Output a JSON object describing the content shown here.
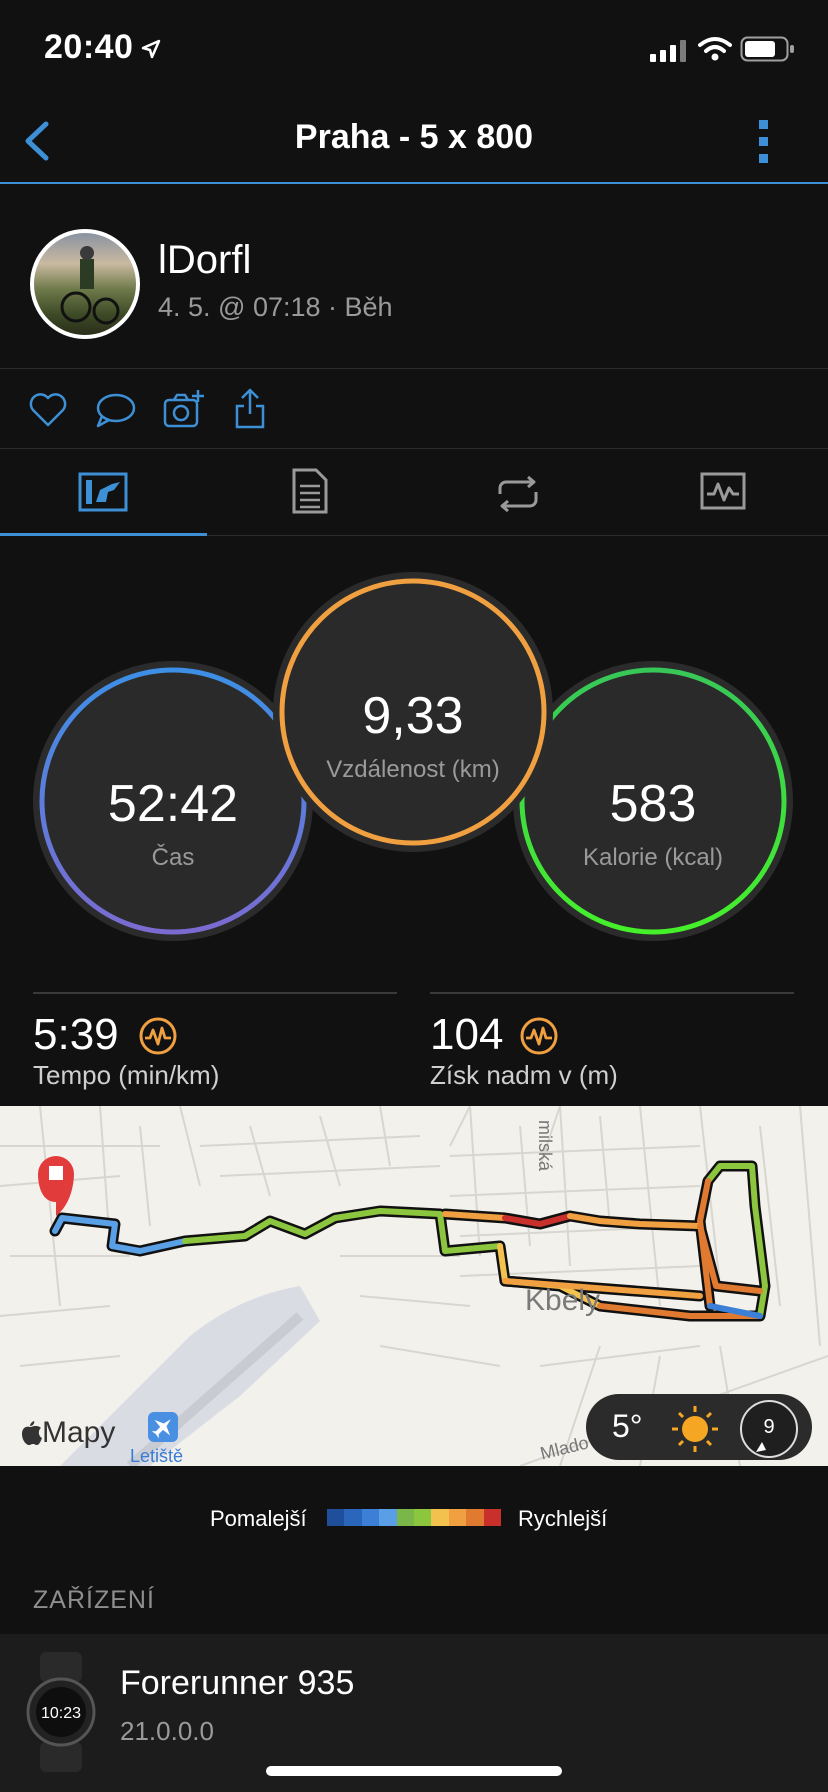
{
  "status_bar": {
    "time": "20:40"
  },
  "nav": {
    "title": "Praha - 5 x 800"
  },
  "activity": {
    "user": "lDorfl",
    "meta": "4. 5. @ 07:18 · Běh"
  },
  "circles": {
    "time": {
      "value": "52:42",
      "label": "Čas"
    },
    "distance": {
      "value": "9,33",
      "label": "Vzdálenost (km)"
    },
    "calories": {
      "value": "583",
      "label": "Kalorie (kcal)"
    }
  },
  "stats": {
    "pace": {
      "value": "5:39",
      "label": "Tempo (min/km)"
    },
    "elevation": {
      "value": "104",
      "label": "Získ nadm v (m)"
    }
  },
  "map": {
    "street_label": "milská",
    "place_label": "Kbely",
    "road_label": "Mlado",
    "airport_label": "Letiště",
    "provider": "Mapy",
    "temperature": "5°",
    "wind": "9"
  },
  "legend": {
    "slower": "Pomalejší",
    "faster": "Rychlejší",
    "colors": [
      "#1f4e9a",
      "#2b66bd",
      "#3b7fd6",
      "#5a9fe6",
      "#7ab648",
      "#8cc63f",
      "#f2c14e",
      "#f0a040",
      "#e07a30",
      "#c9302c"
    ]
  },
  "device_section": {
    "title": "ZAŘÍZENÍ",
    "name": "Forerunner 935",
    "version": "21.0.0.0",
    "watch_time": "10:23"
  },
  "colors": {
    "accent": "#3d8fd6",
    "orange": "#f0a040",
    "green": "#3ddc3d"
  }
}
